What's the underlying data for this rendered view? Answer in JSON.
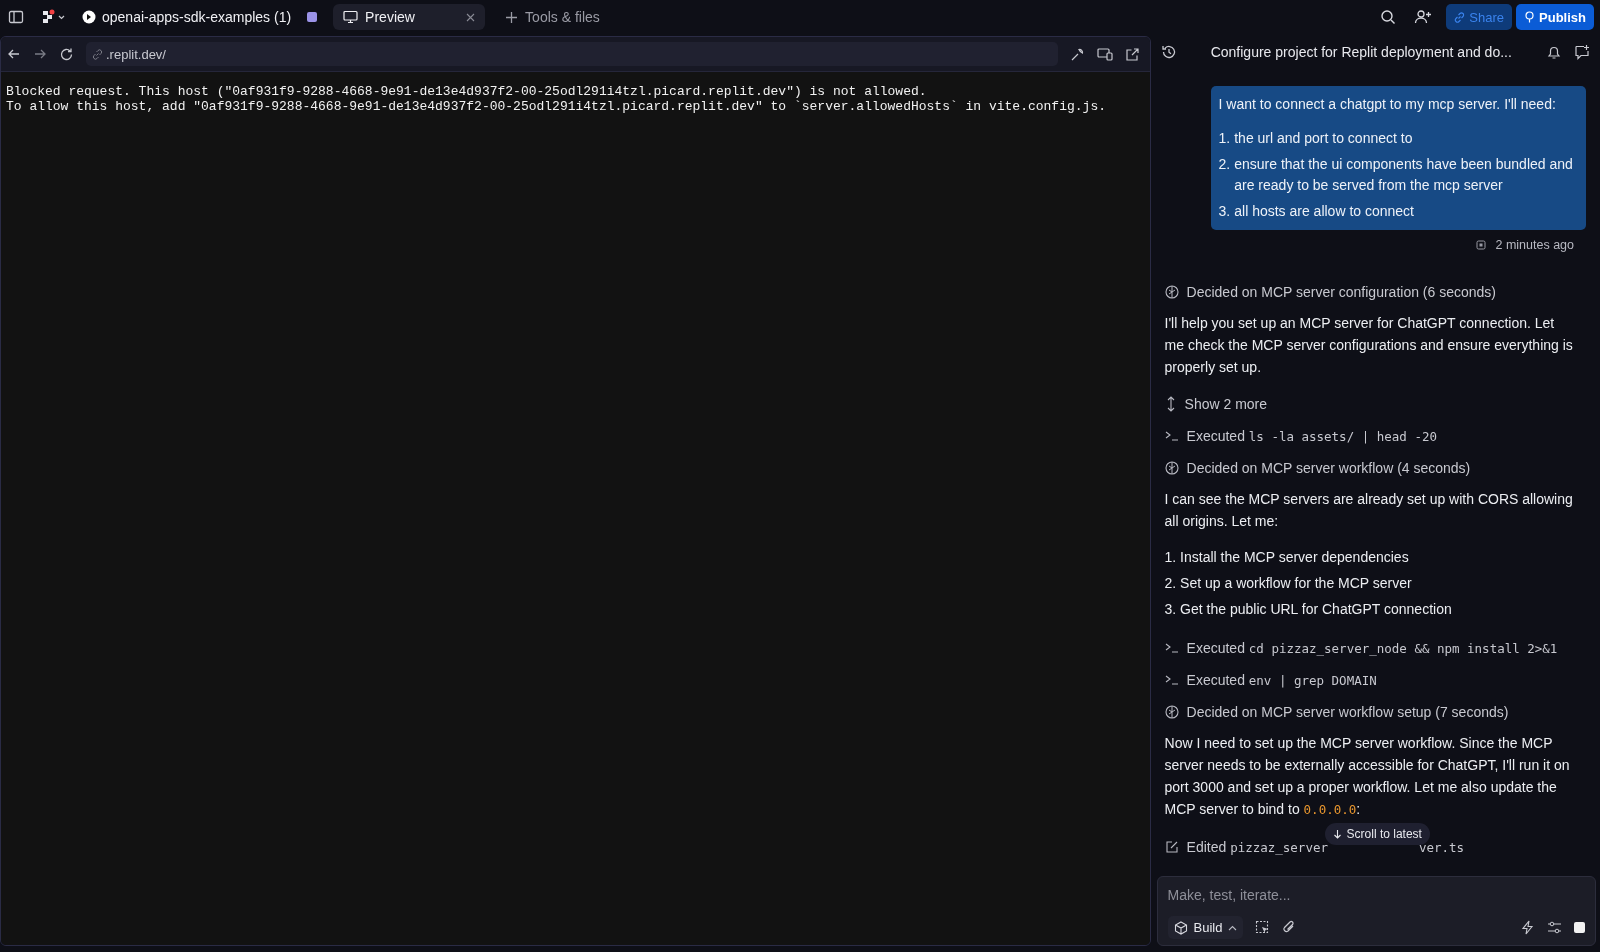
{
  "topbar": {
    "project": "openai-apps-sdk-examples (1)",
    "tabs": [
      {
        "kind": "preview",
        "label": "Preview",
        "selected": true
      },
      {
        "kind": "add",
        "label": "Tools & files",
        "selected": false
      }
    ],
    "share": "Share",
    "publish": "Publish"
  },
  "preview": {
    "url": ".replit.dev/",
    "lines": [
      "Blocked request. This host (\"0af931f9-9288-4668-9e91-de13e4d937f2-00-25odl291i4tzl.picard.replit.dev\") is not allowed.",
      "To allow this host, add \"0af931f9-9288-4668-9e91-de13e4d937f2-00-25odl291i4tzl.picard.replit.dev\" to `server.allowedHosts` in vite.config.js."
    ]
  },
  "chat": {
    "title": "Configure project for Replit deployment and do...",
    "user_message": {
      "intro": "I want to connect a chatgpt to my mcp server. I'll need:",
      "items": [
        {
          "marker": "1.",
          "text": "the url and port to connect to"
        },
        {
          "marker": "2.",
          "text": "ensure that the ui components have been bundled and are ready to be served from the mcp server"
        },
        {
          "marker": "3.",
          "text": "all hosts are allow to connect"
        }
      ],
      "time": "2 minutes ago"
    },
    "entries": [
      {
        "kind": "decided",
        "text": "Decided on MCP server configuration (6 seconds)"
      },
      {
        "kind": "text",
        "text": "I'll help you set up an MCP server for ChatGPT connection. Let me check the MCP server configurations and ensure everything is properly set up."
      },
      {
        "kind": "show_more",
        "text": "Show 2 more"
      },
      {
        "kind": "executed",
        "text": "Executed",
        "code": "ls -la assets/ | head -20"
      },
      {
        "kind": "decided",
        "text": "Decided on MCP server workflow (4 seconds)"
      },
      {
        "kind": "text",
        "text": "I can see the MCP servers are already set up with CORS allowing all origins. Let me:"
      },
      {
        "kind": "list",
        "items": [
          "1. Install the MCP server dependencies",
          "2. Set up a workflow for the MCP server",
          "3. Get the public URL for ChatGPT connection"
        ]
      },
      {
        "kind": "executed",
        "text": "Executed",
        "code": "cd pizzaz_server_node && npm install 2>&1"
      },
      {
        "kind": "executed",
        "text": "Executed",
        "code": "env | grep DOMAIN"
      },
      {
        "kind": "decided",
        "text": "Decided on MCP server workflow setup (7 seconds)"
      },
      {
        "kind": "text",
        "text": "Now I need to set up the MCP server workflow. Since the MCP server needs to be externally accessible for ChatGPT, I'll run it on port 3000 and set up a proper workflow. Let me also update the MCP server to bind to",
        "code": "0.0.0.0",
        "after": ":"
      },
      {
        "kind": "edited",
        "text": "Edited",
        "code": "pizzaz_server",
        "code_end": "ver.ts"
      }
    ],
    "scroll_button": "Scroll to latest",
    "input": {
      "placeholder": "Make, test, iterate...",
      "mode": "Build"
    }
  }
}
